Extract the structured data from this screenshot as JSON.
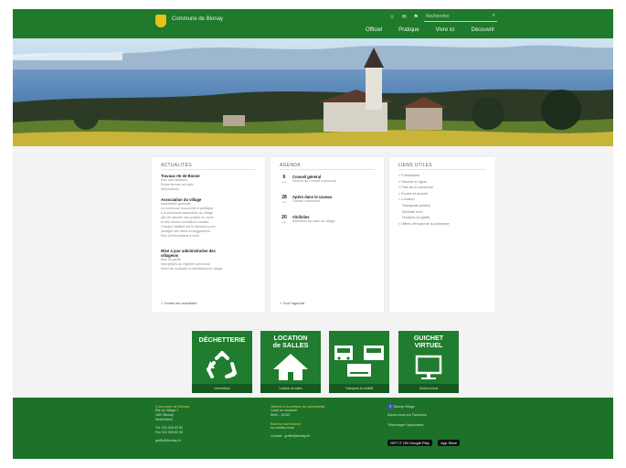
{
  "header": {
    "brand": "Commune de Blonay",
    "icons": "☺ ✉ ⚑",
    "search_placeholder": "Rechercher",
    "nav": [
      "Officiel",
      "Pratique",
      "Vivre ici",
      "Découvrir"
    ]
  },
  "news": {
    "title": "ACTUALITÉS",
    "items": [
      {
        "title": "Travaux rte de Bonne",
        "lines": [
          "Avis aux habitants",
          "Route fermée au trafic",
          "Informations"
        ]
      },
      {
        "title": "Association du village",
        "lines": [
          "Assemblée générale",
          "La commune vous invite à participer",
          "à la prochaine assemblée du village",
          "afin de discuter des projets en cours",
          "et des futures animations locales.",
          "Chaque habitant est le bienvenu pour",
          "partager ses idées et suggestions.",
          "Plus d'informations à venir"
        ]
      },
      {
        "title": "Mise à jour administrative des",
        "title2": "villageois",
        "lines": [
          "Avis du greffe",
          "Inscriptions au registre communal",
          "Merci de contacter le secrétariat du village"
        ]
      }
    ],
    "more": "> Toutes les actualités"
  },
  "agenda": {
    "title": "AGENDA",
    "events": [
      {
        "day": "6",
        "mon": "mai",
        "title": "Conseil général",
        "sub": "Séance du Conseil communal"
      },
      {
        "day": "28",
        "mon": "mai",
        "title": "Apéro dans le caveau",
        "sub": "Caveau communal"
      },
      {
        "day": "20",
        "mon": "juin",
        "title": "Vinifolies",
        "sub": "Animation au cœur du village"
      }
    ],
    "more": "> Tout l'agenda"
  },
  "quicklinks": {
    "title": "LIENS UTILES",
    "items": [
      "> Formulaires",
      "> Guichet en ligne",
      "> Plan de la commune",
      "> Écoles et accueil",
      "> Location",
      "Transports publics",
      "Déchets et tri",
      "Horaires du greffe",
      "> Offres d'emploi de la commune"
    ]
  },
  "tiles": [
    {
      "title1": "DÉCHETTERIE",
      "title2": "",
      "foot": "Informations",
      "icon": "recycle-icon"
    },
    {
      "title1": "LOCATION",
      "title2": "de SALLES",
      "foot": "Location de salles",
      "icon": "house-icon"
    },
    {
      "title1": "",
      "title2": "",
      "foot": "Transports et mobilité",
      "icon": "transport-icon"
    },
    {
      "title1": "GUICHET",
      "title2": "VIRTUEL",
      "foot": "Guichet virtuel",
      "icon": "screen-icon"
    }
  ],
  "footer": {
    "col1": {
      "head": "Commune de Blonay",
      "lines": [
        "Rte du Village 1",
        "1807 Blonay",
        "Switzerland",
        "",
        "Tél. 021 926 82 82",
        "Fax 021 926 82 83",
        "",
        "greffe@blonay.ch"
      ]
    },
    "col2": {
      "head": "Heures d'ouverture du secrétariat",
      "lines": [
        "Lundi au vendredi",
        "8h00 - 11h30",
        "",
        "Bureau communal",
        "sur rendez-vous",
        "",
        "Contact : greffe@blonay.ch"
      ]
    },
    "col3": {
      "facebook": "Blonay Village",
      "lines": [
        "Suivez-nous sur Facebook",
        "",
        "Téléchargez l'application"
      ],
      "badge1": "GET IT ON Google Play",
      "badge2": "App Store"
    }
  },
  "colors": {
    "header": "#1f7a2b",
    "tile": "#207c2e",
    "footer": "#1c7229",
    "accent": "#e8c21c"
  }
}
